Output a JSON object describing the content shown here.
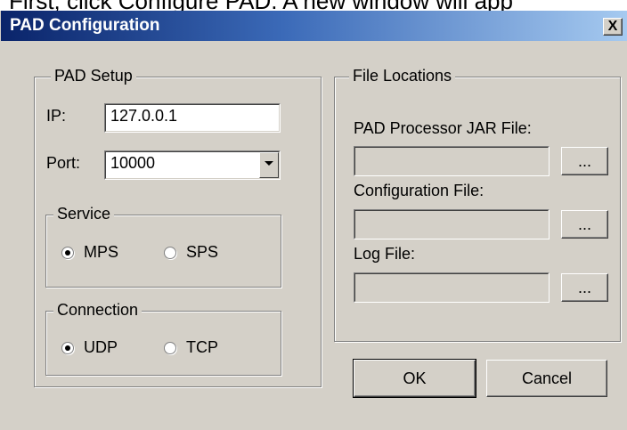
{
  "caption": "First, click Configure PAD. A new window will app",
  "window": {
    "title": "PAD Configuration",
    "close_glyph": "X"
  },
  "pad_setup": {
    "legend": "PAD Setup",
    "ip_label": "IP:",
    "ip_value": "127.0.0.1",
    "port_label": "Port:",
    "port_value": "10000"
  },
  "service": {
    "legend": "Service",
    "options": [
      "MPS",
      "SPS"
    ],
    "selected": "MPS"
  },
  "connection": {
    "legend": "Connection",
    "options": [
      "UDP",
      "TCP"
    ],
    "selected": "UDP"
  },
  "file_locations": {
    "legend": "File Locations",
    "jar_label": "PAD Processor JAR File:",
    "jar_value": "",
    "config_label": "Configuration File:",
    "config_value": "",
    "log_label": "Log File:",
    "log_value": "",
    "browse_label": "..."
  },
  "buttons": {
    "ok": "OK",
    "cancel": "Cancel"
  }
}
